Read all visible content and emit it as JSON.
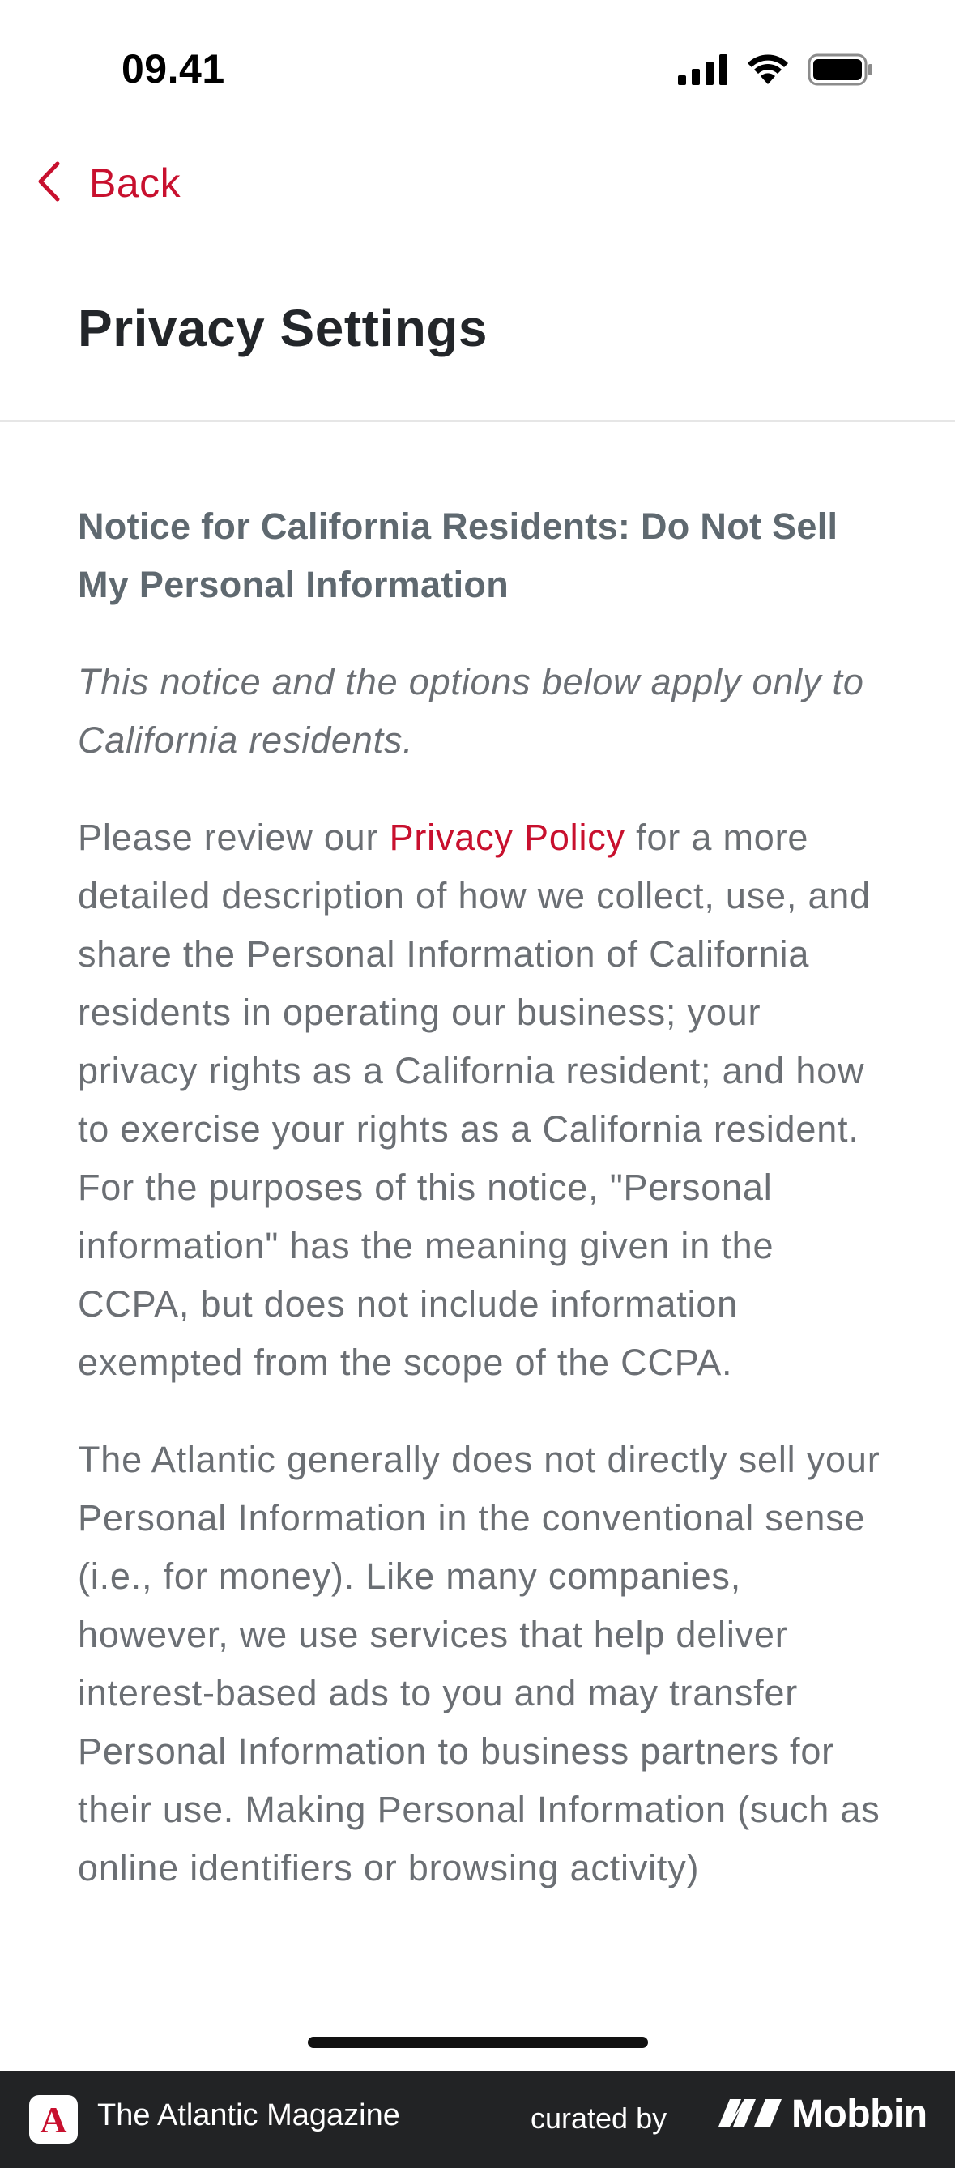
{
  "status_bar": {
    "time": "09.41"
  },
  "nav": {
    "back_label": "Back"
  },
  "page": {
    "title": "Privacy Settings"
  },
  "content": {
    "heading": "Notice for California Residents: Do Not Sell My Personal Information",
    "subheading": "This notice and the options below apply only to California residents.",
    "para1_before": "Please review our ",
    "para1_link": "Privacy Policy",
    "para1_after": " for a more detailed description of how we collect, use, and share the Personal Information of California residents in operating our business; your privacy rights as a California resident; and how to exercise your rights as a California resident. For the purposes of this notice, \"Personal information\" has the meaning given in the CCPA, but does not include information exempted from the scope of the CCPA.",
    "para2": "The Atlantic generally does not directly sell your Personal Information in the conventional sense (i.e., for money). Like many companies, however, we use services that help deliver interest-based ads to you and may transfer Personal Information to business partners for their use. Making Personal Information (such as online identifiers or browsing activity)"
  },
  "footer": {
    "app_badge_letter": "A",
    "app_name": "The Atlantic Magazine",
    "curated_by": "curated by",
    "brand": "Mobbin"
  },
  "colors": {
    "accent": "#c8102e",
    "title": "#23262a",
    "body_text": "#6b6f74",
    "footer_bg": "#222325"
  },
  "icons": {
    "back": "chevron-left-icon",
    "signal": "cellular-signal-icon",
    "wifi": "wifi-icon",
    "battery": "battery-icon",
    "brand_logo": "mobbin-logo-icon"
  }
}
